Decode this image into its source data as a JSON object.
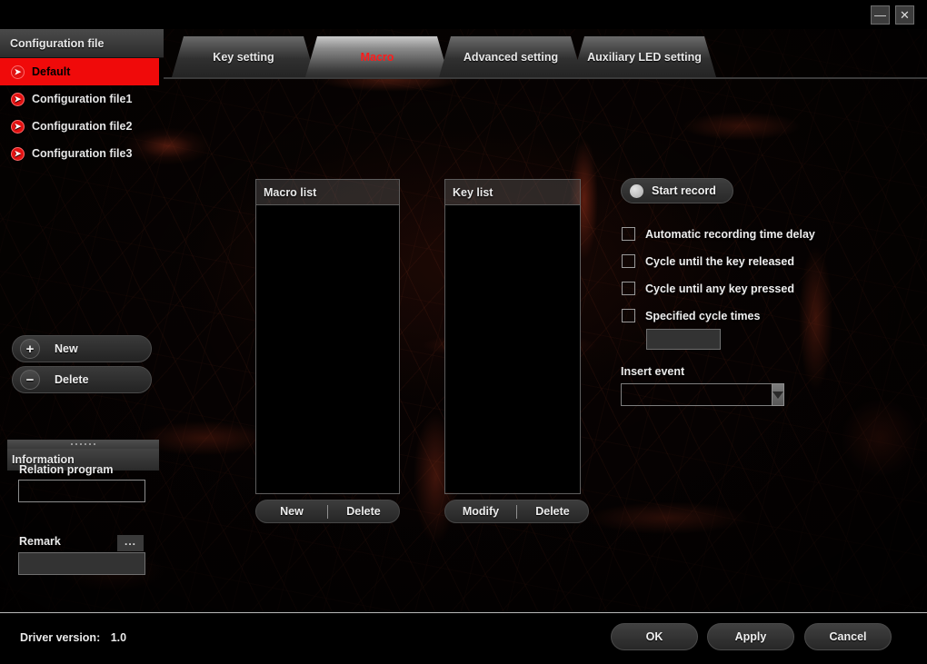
{
  "window": {
    "minimize_label": "—",
    "close_label": "✕"
  },
  "sidebar": {
    "header": "Configuration file",
    "items": [
      {
        "label": "Default",
        "icon": "config-profile-icon",
        "active": true
      },
      {
        "label": "Configuration file1",
        "icon": "config-profile-icon",
        "active": false
      },
      {
        "label": "Configuration file2",
        "icon": "config-profile-icon",
        "active": false
      },
      {
        "label": "Configuration file3",
        "icon": "config-profile-icon",
        "active": false
      }
    ],
    "new_label": "New",
    "new_icon": "plus-icon",
    "delete_label": "Delete",
    "delete_icon": "minus-icon",
    "information_header": "Information",
    "relation_program_label": "Relation program",
    "relation_program_value": "",
    "browse_label": "...",
    "remark_label": "Remark",
    "remark_value": ""
  },
  "tabs": [
    {
      "label": "Key setting",
      "active": false
    },
    {
      "label": "Macro",
      "active": true
    },
    {
      "label": "Advanced setting",
      "active": false
    },
    {
      "label": "Auxiliary LED setting",
      "active": false
    }
  ],
  "macro_panel": {
    "macro_list": {
      "title": "Macro list",
      "items": [],
      "new_label": "New",
      "delete_label": "Delete"
    },
    "key_list": {
      "title": "Key list",
      "items": [],
      "modify_label": "Modify",
      "delete_label": "Delete"
    },
    "record": {
      "label": "Start record",
      "indicator_icon": "record-dot-icon"
    },
    "options": [
      {
        "label": "Automatic recording time delay",
        "checked": false
      },
      {
        "label": "Cycle until the key released",
        "checked": false
      },
      {
        "label": "Cycle until any key pressed",
        "checked": false
      },
      {
        "label": "Specified cycle times",
        "checked": false
      }
    ],
    "cycle_times_value": "",
    "insert_event": {
      "label": "Insert event",
      "value": "",
      "arrow_icon": "chevron-down-icon"
    }
  },
  "footer": {
    "driver_version_label": "Driver version:",
    "driver_version_value": "1.0",
    "ok_label": "OK",
    "apply_label": "Apply",
    "cancel_label": "Cancel"
  },
  "colors": {
    "accent_red": "#f00a0a",
    "active_tab_text": "#ff1b1b",
    "background": "#000000"
  }
}
